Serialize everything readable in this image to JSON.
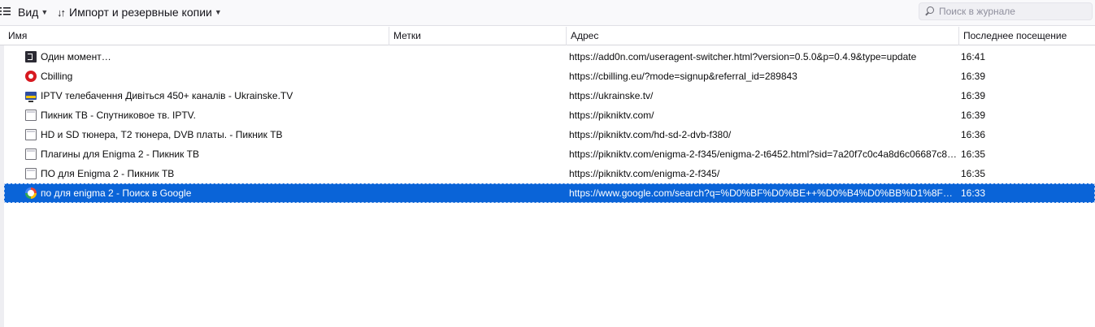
{
  "toolbar": {
    "menu_icon": "organize-menu-icon",
    "view_label": "Вид",
    "import_label": "Импорт и резервные копии",
    "search_placeholder": "Поиск в журнале"
  },
  "columns": {
    "name": "Имя",
    "tags": "Метки",
    "url": "Адрес",
    "date": "Последнее посещение"
  },
  "rows": [
    {
      "icon": "addon-icon",
      "name": "Один момент…",
      "url": "https://add0n.com/useragent-switcher.html?version=0.5.0&p=0.4.9&type=update",
      "date": "16:41"
    },
    {
      "icon": "cbilling-icon",
      "name": "Cbilling",
      "url": "https://cbilling.eu/?mode=signup&referral_id=289843",
      "date": "16:39"
    },
    {
      "icon": "tv-icon",
      "name": "IPTV телебачення Дивіться 450+ каналів - Ukrainske.TV",
      "url": "https://ukrainske.tv/",
      "date": "16:39"
    },
    {
      "icon": "page-icon",
      "name": "Пикник ТВ - Спутниковое тв. IPTV.",
      "url": "https://pikniktv.com/",
      "date": "16:39"
    },
    {
      "icon": "page-icon",
      "name": "HD и SD тюнера, T2 тюнера, DVB платы. - Пикник ТВ",
      "url": "https://pikniktv.com/hd-sd-2-dvb-f380/",
      "date": "16:36"
    },
    {
      "icon": "page-icon",
      "name": "Плагины для Enigma 2 - Пикник ТВ",
      "url": "https://pikniktv.com/enigma-2-f345/enigma-2-t6452.html?sid=7a20f7c0c4a8d6c06687c8…",
      "date": "16:35"
    },
    {
      "icon": "page-icon",
      "name": "ПО для Enigma 2 - Пикник ТВ",
      "url": "https://pikniktv.com/enigma-2-f345/",
      "date": "16:35"
    },
    {
      "icon": "google-icon",
      "name": "по для enigma 2 - Поиск в Google",
      "url": "https://www.google.com/search?q=%D0%BF%D0%BE++%D0%B4%D0%BB%D1%8F+eni…",
      "date": "16:33",
      "selected": true
    }
  ],
  "colors": {
    "selection": "#0a64d8",
    "toolbar_bg": "#f9f9fb"
  }
}
